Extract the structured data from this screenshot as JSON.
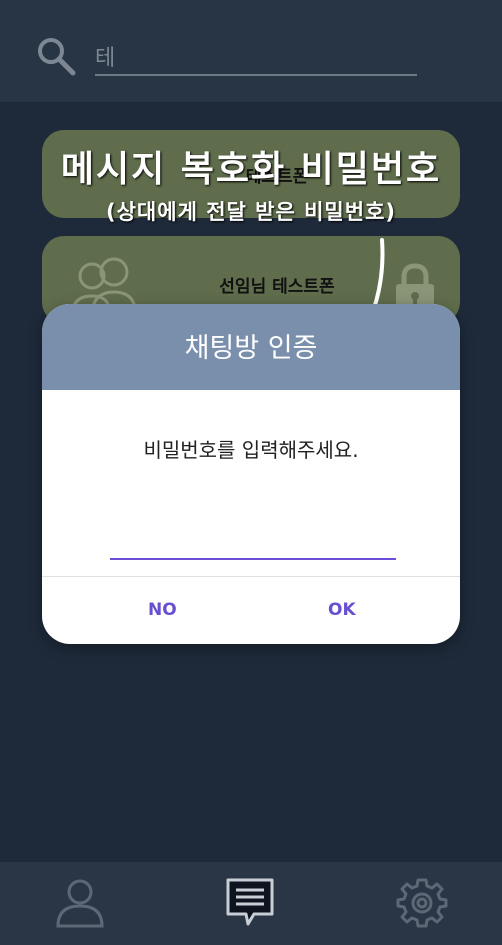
{
  "search": {
    "value": "테"
  },
  "rooms": [
    {
      "name": "테스트폰"
    },
    {
      "name": "선임님  테스트폰"
    }
  ],
  "annotation": {
    "title": "메시지 복호화 비밀번호",
    "subtitle": "(상대에게 전달 받은 비밀번호)"
  },
  "dialog": {
    "title": "채팅방 인증",
    "message": "비밀번호를 입력해주세요.",
    "password_value": "",
    "no_label": "NO",
    "ok_label": "OK"
  },
  "nav": {
    "items": [
      {
        "icon": "profile-icon"
      },
      {
        "icon": "chat-icon"
      },
      {
        "icon": "gear-icon"
      }
    ]
  },
  "colors": {
    "background": "#1e2a3a",
    "dialog_header": "#7a8fac",
    "accent": "#6a4fd0",
    "room_item": "#5f6d4c"
  }
}
